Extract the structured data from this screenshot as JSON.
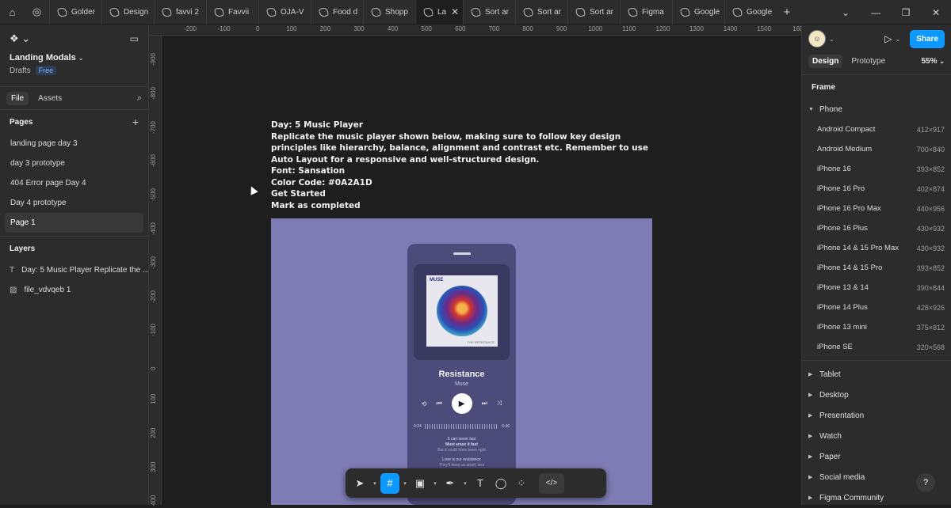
{
  "tabs": [
    {
      "label": "Golder"
    },
    {
      "label": "Design"
    },
    {
      "label": "favvi 2"
    },
    {
      "label": "Favvii"
    },
    {
      "label": "OJA-V"
    },
    {
      "label": "Food d"
    },
    {
      "label": "Shopp"
    },
    {
      "label": "La",
      "active": true
    },
    {
      "label": "Sort ar"
    },
    {
      "label": "Sort ar"
    },
    {
      "label": "Sort ar"
    },
    {
      "label": "Figma"
    },
    {
      "label": "Google"
    },
    {
      "label": "Google"
    }
  ],
  "left_panel": {
    "project_name": "Landing Modals",
    "location": "Drafts",
    "plan_badge": "Free",
    "tab_file": "File",
    "tab_assets": "Assets",
    "pages_heading": "Pages",
    "pages": [
      {
        "label": "landing page day 3"
      },
      {
        "label": "day 3 prototype"
      },
      {
        "label": "404 Error page Day 4"
      },
      {
        "label": "Day  4 prototype"
      },
      {
        "label": "Page 1",
        "active": true
      }
    ],
    "layers_heading": "Layers",
    "layers": [
      {
        "label": "Day: 5 Music Player Replicate the ...",
        "icon": "text-icon"
      },
      {
        "label": "file_vdvqeb 1",
        "icon": "image-icon"
      }
    ]
  },
  "ruler_top": [
    "-200",
    "-100",
    "0",
    "100",
    "200",
    "300",
    "400",
    "500",
    "600",
    "700",
    "800",
    "900",
    "1000",
    "1100",
    "1200",
    "1300",
    "1400",
    "1500",
    "160"
  ],
  "ruler_left": [
    "-900",
    "-800",
    "-700",
    "-600",
    "-500",
    "-400",
    "-300",
    "-200",
    "-100",
    "0",
    "100",
    "200",
    "300",
    "400"
  ],
  "canvas": {
    "brief_lines": [
      "Day: 5 Music Player",
      "Replicate the music player shown below, making sure to follow key design principles like hierarchy, balance, alignment and contrast etc. Remember to use Auto Layout for a responsive and well-structured design.",
      "Font: Sansation",
      "Color Code: #0A2A1D",
      "Get Started",
      "Mark as completed"
    ],
    "artboard_color": "#7f7cb5",
    "player": {
      "album_brand": "MUSE",
      "album_name": "THE RESISTANCE",
      "title": "Resistance",
      "artist": "Muse",
      "time_current": "0:24",
      "time_total": "5:46",
      "lyrics": [
        "It can never last",
        "Must erase it fast",
        "But it could have been right",
        "Love is our resistance",
        "They'll keep us apart, and"
      ]
    }
  },
  "toolbar": {
    "tools": [
      "move-tool",
      "frame-tool",
      "image-tool",
      "pen-tool",
      "text-tool",
      "comment-tool",
      "actions-tool"
    ],
    "dev_mode_label": "</>"
  },
  "right_panel": {
    "share_label": "Share",
    "tab_design": "Design",
    "tab_prototype": "Prototype",
    "zoom": "55%",
    "frame_heading": "Frame",
    "phone_category": "Phone",
    "phone_presets": [
      {
        "name": "Android Compact",
        "size": "412×917"
      },
      {
        "name": "Android Medium",
        "size": "700×840"
      },
      {
        "name": "iPhone 16",
        "size": "393×852"
      },
      {
        "name": "iPhone 16 Pro",
        "size": "402×874"
      },
      {
        "name": "iPhone 16 Pro Max",
        "size": "440×956"
      },
      {
        "name": "iPhone 16 Plus",
        "size": "430×932"
      },
      {
        "name": "iPhone 14 & 15 Pro Max",
        "size": "430×932"
      },
      {
        "name": "iPhone 14 & 15 Pro",
        "size": "393×852"
      },
      {
        "name": "iPhone 13 & 14",
        "size": "390×844"
      },
      {
        "name": "iPhone 14 Plus",
        "size": "428×926"
      },
      {
        "name": "iPhone 13 mini",
        "size": "375×812"
      },
      {
        "name": "iPhone SE",
        "size": "320×568"
      }
    ],
    "other_categories": [
      "Tablet",
      "Desktop",
      "Presentation",
      "Watch",
      "Paper",
      "Social media",
      "Figma Community"
    ],
    "help_label": "?"
  },
  "colors": {
    "accent": "#0d99ff",
    "panel": "#2c2c2c",
    "canvas": "#1e1e1e"
  }
}
